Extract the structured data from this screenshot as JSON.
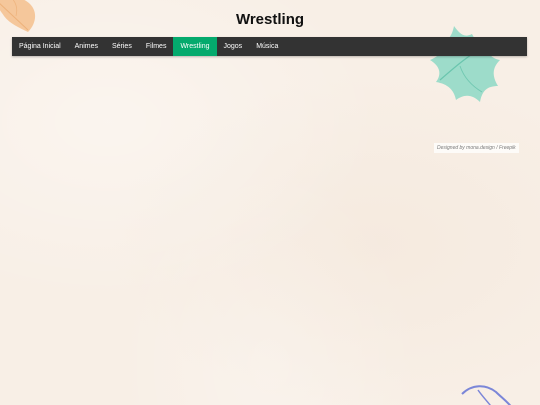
{
  "page": {
    "title": "Wrestling"
  },
  "navbar": {
    "items": [
      {
        "label": "Página Inicial",
        "active": false
      },
      {
        "label": "Animes",
        "active": false
      },
      {
        "label": "Séries",
        "active": false
      },
      {
        "label": "Filmes",
        "active": false
      },
      {
        "label": "Wrestling",
        "active": true
      },
      {
        "label": "Jogos",
        "active": false
      },
      {
        "label": "Música",
        "active": false
      }
    ],
    "active_color": "#04aa6d",
    "background_color": "#333333"
  },
  "credit": {
    "text": "Designed by mona.design / Freepik"
  },
  "decorations": [
    "orange-leaf",
    "mint-leaf",
    "blue-leaf-outline"
  ]
}
